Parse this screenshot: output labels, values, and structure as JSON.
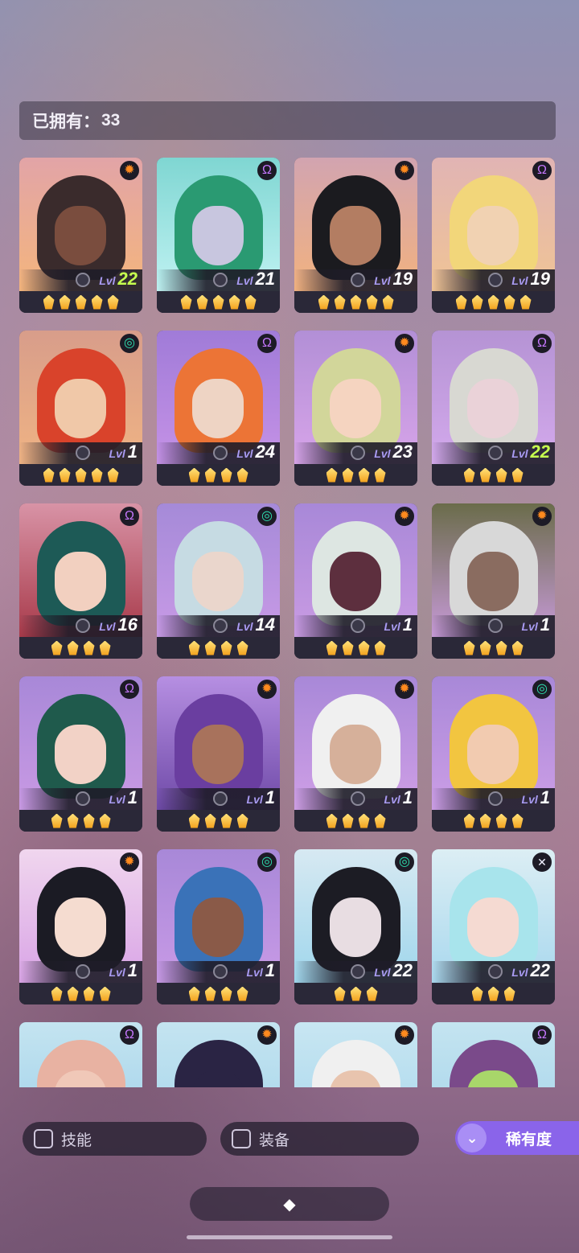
{
  "header": {
    "owned_label": "已拥有：",
    "owned_count": "33"
  },
  "level_label": "Lvl",
  "cards": [
    {
      "bg": "#f4b57d",
      "bg2": "#e2a4a7",
      "hair": "#3a2b2c",
      "skin": "#7a4d3e",
      "badge": "sun",
      "level": "22",
      "green": true,
      "stars": 5
    },
    {
      "bg": "#bff2f2",
      "bg2": "#7fd6d2",
      "hair": "#2a9a72",
      "skin": "#c8c6df",
      "badge": "psi",
      "level": "21",
      "green": false,
      "stars": 5
    },
    {
      "bg": "#f2b27f",
      "bg2": "#d2a4b0",
      "hair": "#1b1b1f",
      "skin": "#b37d62",
      "badge": "sun",
      "level": "19",
      "green": false,
      "stars": 5
    },
    {
      "bg": "#f0c495",
      "bg2": "#e1b4b4",
      "hair": "#f2d67a",
      "skin": "#f1d2b2",
      "badge": "psi",
      "level": "19",
      "green": false,
      "stars": 5
    },
    {
      "bg": "#efb384",
      "bg2": "#d89d8a",
      "hair": "#d9432b",
      "skin": "#f0c8a8",
      "badge": "wave",
      "level": "1",
      "green": false,
      "stars": 5
    },
    {
      "bg": "#c592e6",
      "bg2": "#a07bd8",
      "hair": "#ec7436",
      "skin": "#eed4c4",
      "badge": "psi",
      "level": "24",
      "green": false,
      "stars": 4
    },
    {
      "bg": "#d7a4e9",
      "bg2": "#b28fd6",
      "hair": "#d2d69a",
      "skin": "#f5d4c0",
      "badge": "sun",
      "level": "23",
      "green": false,
      "stars": 4
    },
    {
      "bg": "#d3a9ec",
      "bg2": "#b593d4",
      "hair": "#d8d8d2",
      "skin": "#ead2d8",
      "badge": "psi",
      "level": "22",
      "green": true,
      "stars": 4
    },
    {
      "bg": "#a83a4a",
      "bg2": "#d893a6",
      "hair": "#1d5a56",
      "skin": "#f2d0c0",
      "badge": "psi",
      "level": "16",
      "green": false,
      "stars": 4
    },
    {
      "bg": "#c89ae6",
      "bg2": "#a58ad8",
      "hair": "#c6dbe3",
      "skin": "#ead6cc",
      "badge": "wave",
      "level": "14",
      "green": false,
      "stars": 4
    },
    {
      "bg": "#c99be3",
      "bg2": "#a888d8",
      "hair": "#dde6e2",
      "skin": "#5d2f3e",
      "badge": "sun",
      "level": "1",
      "green": false,
      "stars": 4
    },
    {
      "bg": "#c79ad8",
      "bg2": "#6a6c4a",
      "hair": "#d8d8d8",
      "skin": "#8a6c60",
      "badge": "sun",
      "level": "1",
      "green": false,
      "stars": 4
    },
    {
      "bg": "#c99ae4",
      "bg2": "#a888d8",
      "hair": "#1f5a4c",
      "skin": "#f2d2c6",
      "badge": "psi",
      "level": "1",
      "green": false,
      "stars": 4
    },
    {
      "bg": "#6f4aa8",
      "bg2": "#b68fe2",
      "hair": "#6a3ea0",
      "skin": "#a8725c",
      "badge": "sun",
      "level": "1",
      "green": false,
      "stars": 4
    },
    {
      "bg": "#cf9fe6",
      "bg2": "#a888d8",
      "hair": "#f0f0f0",
      "skin": "#d6b09a",
      "badge": "sun",
      "level": "1",
      "green": false,
      "stars": 4
    },
    {
      "bg": "#cc9ee6",
      "bg2": "#a888d8",
      "hair": "#f2c540",
      "skin": "#f2cbb0",
      "badge": "wave",
      "level": "1",
      "green": false,
      "stars": 4
    },
    {
      "bg": "#d9a4e6",
      "bg2": "#f0d6ee",
      "hair": "#1b1b24",
      "skin": "#f5dcd0",
      "badge": "sun",
      "level": "1",
      "green": false,
      "stars": 4
    },
    {
      "bg": "#c89ae6",
      "bg2": "#a888d8",
      "hair": "#3a72b8",
      "skin": "#8a5a48",
      "badge": "wave",
      "level": "1",
      "green": false,
      "stars": 4
    },
    {
      "bg": "#9fd6ec",
      "bg2": "#d7e9f2",
      "hair": "#1c1c24",
      "skin": "#e8dde2",
      "badge": "wave",
      "level": "22",
      "green": false,
      "stars": 3
    },
    {
      "bg": "#a9d8ee",
      "bg2": "#dceef4",
      "hair": "#a8e4ec",
      "skin": "#f5dad2",
      "badge": "cross",
      "level": "22",
      "green": false,
      "stars": 3
    },
    {
      "bg": "#9ccfea",
      "bg2": "#c4e4f0",
      "hair": "#e8b2a2",
      "skin": "#f0c8b8",
      "badge": "psi",
      "level": "",
      "green": false,
      "stars": 0
    },
    {
      "bg": "#a3d4ec",
      "bg2": "#c4e4f0",
      "hair": "#2a2444",
      "skin": "#2a2444",
      "badge": "sun",
      "level": "",
      "green": false,
      "stars": 0
    },
    {
      "bg": "#a6d6ec",
      "bg2": "#c8e6f2",
      "hair": "#f0f0f0",
      "skin": "#e8c4ae",
      "badge": "sun",
      "level": "",
      "green": false,
      "stars": 0
    },
    {
      "bg": "#a2d2ea",
      "bg2": "#c4e4f0",
      "hair": "#7a4a8a",
      "skin": "#a8d66a",
      "badge": "psi",
      "level": "",
      "green": false,
      "stars": 0
    }
  ],
  "badge_icons": {
    "sun": "✹",
    "psi": "Ω",
    "wave": "◎",
    "cross": "✕"
  },
  "filters": {
    "skill_label": "技能",
    "equip_label": "装备"
  },
  "rarity_button": {
    "label": "稀有度",
    "icon": "⌄"
  },
  "bottom_button": {
    "icon": "◆"
  }
}
